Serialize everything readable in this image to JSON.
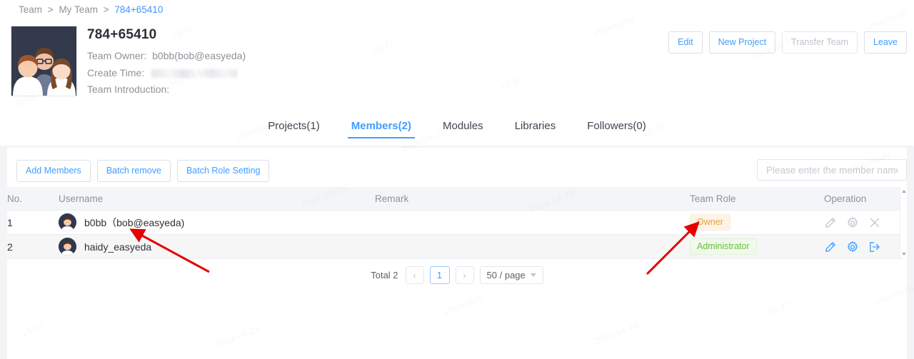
{
  "breadcrumb": {
    "root": "Team",
    "sep": ">",
    "parent": "My Team",
    "current": "784+65410"
  },
  "team": {
    "avatar_alt": "team-illustration",
    "title": "784+65410",
    "owner_label": "Team Owner:",
    "owner_value": "b0bb(bob@easyeda)",
    "create_time_label": "Create Time:",
    "create_time_value": "",
    "introduction_label": "Team Introduction:",
    "introduction_value": ""
  },
  "header_actions": [
    {
      "label": "Edit",
      "name": "edit-button",
      "disabled": false
    },
    {
      "label": "New Project",
      "name": "new-project-button",
      "disabled": false
    },
    {
      "label": "Transfer Team",
      "name": "transfer-team-button",
      "disabled": true
    },
    {
      "label": "Leave",
      "name": "leave-button",
      "disabled": false
    }
  ],
  "tabs": [
    {
      "label": "Projects(1)",
      "active": false
    },
    {
      "label": "Members(2)",
      "active": true
    },
    {
      "label": "Modules",
      "active": false
    },
    {
      "label": "Libraries",
      "active": false
    },
    {
      "label": "Followers(0)",
      "active": false
    }
  ],
  "toolbar": {
    "add_members_label": "Add Members",
    "batch_remove_label": "Batch remove",
    "batch_role_setting_label": "Batch Role Setting"
  },
  "search": {
    "value": "",
    "placeholder": "Please enter the member name"
  },
  "table": {
    "headers": [
      "No.",
      "Username",
      "Remark",
      "Team Role",
      "Operation"
    ],
    "rows": [
      {
        "no": "1",
        "username": "b0bb（bob@easyeda)",
        "remark": "",
        "role": "Owner",
        "role_type": "owner",
        "ops": [
          {
            "icon": "pencil-icon",
            "disabled": true
          },
          {
            "icon": "gear-icon",
            "disabled": true
          },
          {
            "icon": "close-icon",
            "disabled": true
          }
        ]
      },
      {
        "no": "2",
        "username": "haidy_easyeda",
        "remark": "",
        "role": "Administrator",
        "role_type": "admin",
        "ops": [
          {
            "icon": "pencil-icon",
            "disabled": false
          },
          {
            "icon": "gear-icon",
            "disabled": false
          },
          {
            "icon": "exit-icon",
            "disabled": false
          }
        ]
      }
    ]
  },
  "pagination": {
    "total_label": "Total 2",
    "prev_label": "‹",
    "current_page": "1",
    "next_label": "›",
    "page_size_label": "50 / page"
  },
  "colors": {
    "accent_blue": "#409eff",
    "owner_orange": "#e6a23c",
    "admin_green": "#67c23a",
    "annotation_red": "#e60000",
    "page_grey": "#f3f4f6"
  },
  "watermark": {
    "date_text": "2024-04-25",
    "time_text": "15:37",
    "user_text": "chenhaidy"
  }
}
